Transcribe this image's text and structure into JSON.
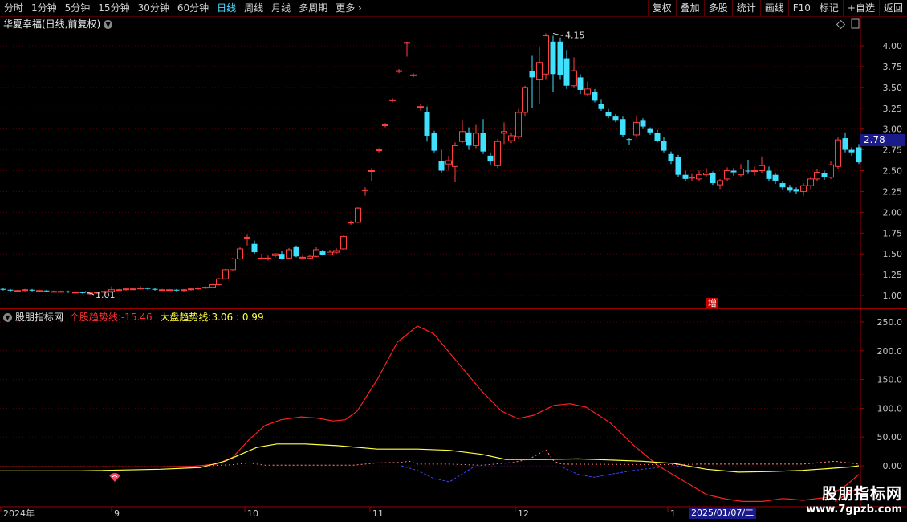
{
  "toolbar": {
    "periods": [
      {
        "label": "分时",
        "active": false
      },
      {
        "label": "1分钟",
        "active": false
      },
      {
        "label": "5分钟",
        "active": false
      },
      {
        "label": "15分钟",
        "active": false
      },
      {
        "label": "30分钟",
        "active": false
      },
      {
        "label": "60分钟",
        "active": false
      },
      {
        "label": "日线",
        "active": true
      },
      {
        "label": "周线",
        "active": false
      },
      {
        "label": "月线",
        "active": false
      },
      {
        "label": "多周期",
        "active": false
      }
    ],
    "more_label": "更多",
    "more_icon": "chevron-right-icon",
    "right_buttons": [
      "复权",
      "叠加",
      "多股",
      "统计",
      "画线",
      "F10",
      "标记",
      "+自选",
      "返回"
    ]
  },
  "main_chart": {
    "stock_title": "华夏幸福(日线,前复权)",
    "price_axis_labels": [
      "4.00",
      "3.75",
      "3.50",
      "3.25",
      "3.00",
      "2.75",
      "2.50",
      "2.25",
      "2.00",
      "1.75",
      "1.50",
      "1.25",
      "1.00"
    ],
    "current_price": "2.78",
    "high_annotation": "4.15",
    "low_annotation": "1.01",
    "zeng_badge": "增",
    "colors": {
      "up": "#ff4040",
      "down": "#40e0ff",
      "bg": "#000000",
      "grid": "#5a0000"
    }
  },
  "indicator": {
    "name": "股朋指标网",
    "line1_label": "个股趋势线:",
    "line1_value": "-15.46",
    "line2_label": "大盘趋势线:",
    "line2_value": "3.06",
    "line3_value": "0.99",
    "axis_labels": [
      "250.0",
      "200.0",
      "150.0",
      "100.0",
      "50.00",
      "0.00"
    ],
    "colors": {
      "line1": "#ff2020",
      "line2": "#ffff40",
      "line3": "#4040ff"
    }
  },
  "time_axis": {
    "labels": [
      "2024年",
      "9",
      "10",
      "11",
      "12",
      "1"
    ],
    "cursor_date": "2025/01/07/二"
  },
  "watermark": {
    "title": "股朋指标网",
    "url": "www.7gpzb.com"
  }
}
